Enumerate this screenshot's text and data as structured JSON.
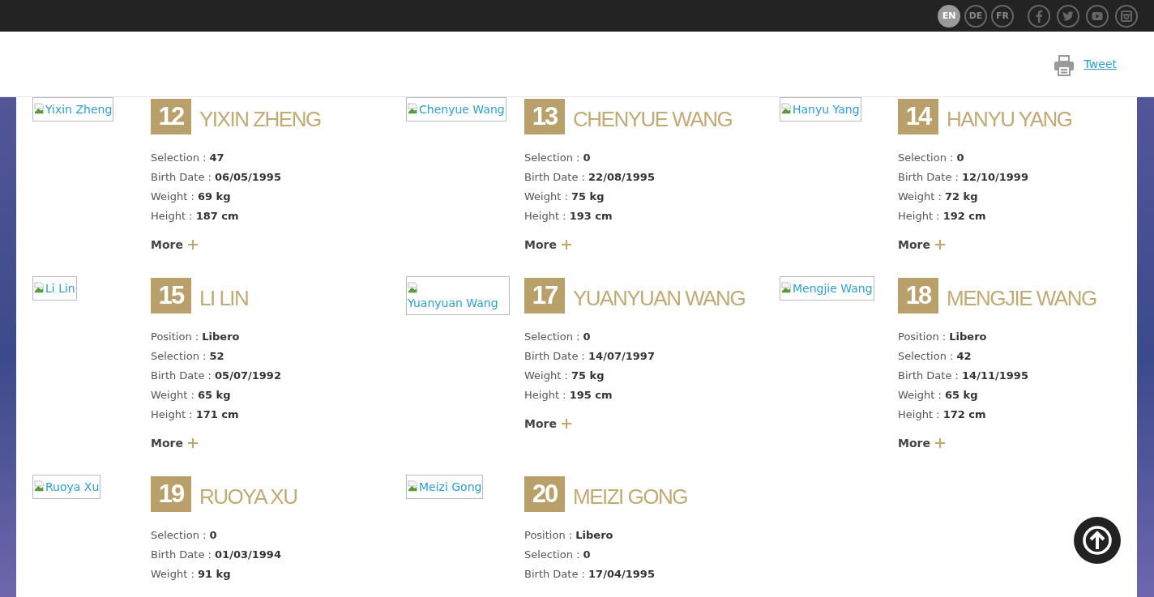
{
  "top_bar": {
    "languages": [
      {
        "label": "EN",
        "selected": true
      },
      {
        "label": "DE",
        "selected": false
      },
      {
        "label": "FR",
        "selected": false
      }
    ],
    "social": [
      {
        "kind": "facebook"
      },
      {
        "kind": "twitter"
      },
      {
        "kind": "youtube"
      },
      {
        "kind": "instagram"
      }
    ]
  },
  "header": {
    "tweet": "Tweet"
  },
  "players": [
    {
      "number": "12",
      "name": "YIXIN ZHENG",
      "photo_alt": "Yixin Zheng",
      "stats": [
        {
          "label": "Selection :",
          "value": "47"
        },
        {
          "label": "Birth Date :",
          "value": "06/05/1995"
        },
        {
          "label": "Weight :",
          "value": "69 kg"
        },
        {
          "label": "Height :",
          "value": "187 cm"
        }
      ],
      "more": "More"
    },
    {
      "number": "13",
      "name": "CHENYUE WANG",
      "photo_alt": "Chenyue Wang",
      "stats": [
        {
          "label": "Selection :",
          "value": "0"
        },
        {
          "label": "Birth Date :",
          "value": "22/08/1995"
        },
        {
          "label": "Weight :",
          "value": "75 kg"
        },
        {
          "label": "Height :",
          "value": "193 cm"
        }
      ],
      "more": "More"
    },
    {
      "number": "14",
      "name": "HANYU YANG",
      "photo_alt": "Hanyu Yang",
      "stats": [
        {
          "label": "Selection :",
          "value": "0"
        },
        {
          "label": "Birth Date :",
          "value": "12/10/1999"
        },
        {
          "label": "Weight :",
          "value": "72 kg"
        },
        {
          "label": "Height :",
          "value": "192 cm"
        }
      ],
      "more": "More"
    },
    {
      "number": "15",
      "name": "LI LIN",
      "photo_alt": "Li Lin",
      "stats": [
        {
          "label": "Position :",
          "value": "Libero"
        },
        {
          "label": "Selection :",
          "value": "52"
        },
        {
          "label": "Birth Date :",
          "value": "05/07/1992"
        },
        {
          "label": "Weight :",
          "value": "65 kg"
        },
        {
          "label": "Height :",
          "value": "171 cm"
        }
      ],
      "more": "More"
    },
    {
      "number": "17",
      "name": "YUANYUAN WANG",
      "photo_alt": "Yuanyuan Wang",
      "stats": [
        {
          "label": "Selection :",
          "value": "0"
        },
        {
          "label": "Birth Date :",
          "value": "14/07/1997"
        },
        {
          "label": "Weight :",
          "value": "75 kg"
        },
        {
          "label": "Height :",
          "value": "195 cm"
        }
      ],
      "more": "More"
    },
    {
      "number": "18",
      "name": "MENGJIE WANG",
      "photo_alt": "Mengjie Wang",
      "stats": [
        {
          "label": "Position :",
          "value": "Libero"
        },
        {
          "label": "Selection :",
          "value": "42"
        },
        {
          "label": "Birth Date :",
          "value": "14/11/1995"
        },
        {
          "label": "Weight :",
          "value": "65 kg"
        },
        {
          "label": "Height :",
          "value": "172 cm"
        }
      ],
      "more": "More"
    },
    {
      "number": "19",
      "name": "RUOYA XU",
      "photo_alt": "Ruoya Xu",
      "stats": [
        {
          "label": "Selection :",
          "value": "0"
        },
        {
          "label": "Birth Date :",
          "value": "01/03/1994"
        },
        {
          "label": "Weight :",
          "value": "91 kg"
        }
      ]
    },
    {
      "number": "20",
      "name": "MEIZI GONG",
      "photo_alt": "Meizi Gong",
      "stats": [
        {
          "label": "Position :",
          "value": "Libero"
        },
        {
          "label": "Selection :",
          "value": "0"
        },
        {
          "label": "Birth Date :",
          "value": "17/04/1995"
        }
      ]
    }
  ]
}
